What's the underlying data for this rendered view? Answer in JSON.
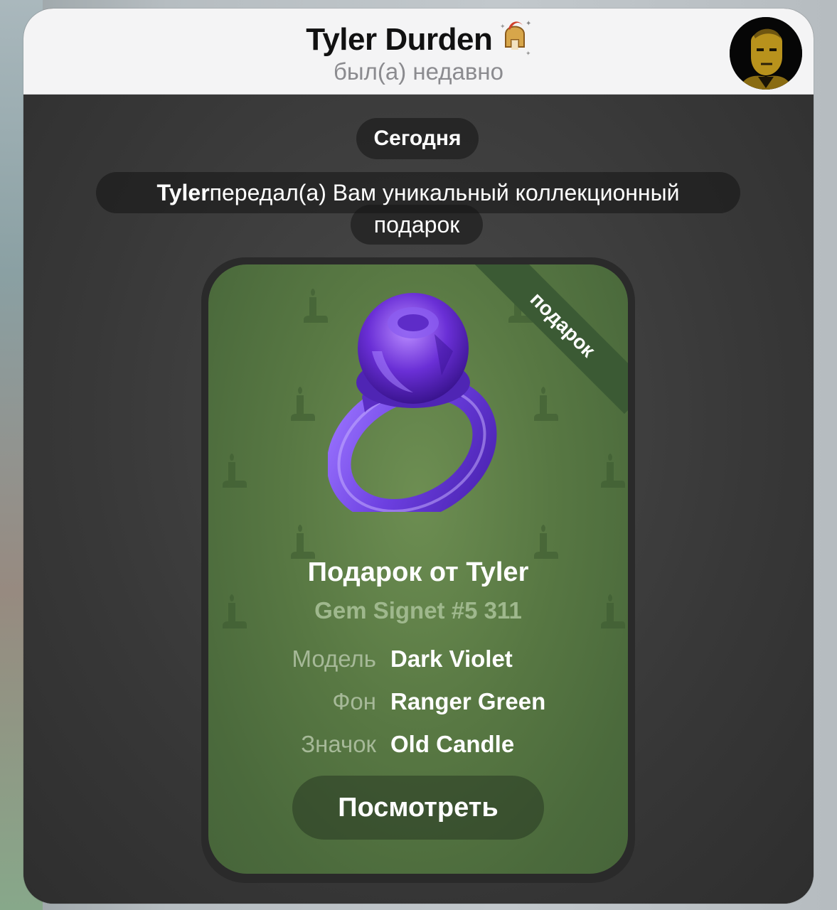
{
  "header": {
    "contact_name": "Tyler Durden",
    "status": "был(а) недавно",
    "emoji_status_icon": "spartan-helmet-icon",
    "avatar": "contact-avatar"
  },
  "chat": {
    "date_label": "Сегодня",
    "service_message": {
      "sender": "Tyler",
      "text_line1": " передал(а) Вам уникальный коллекционный",
      "text_line2": "подарок"
    },
    "gift_card": {
      "ribbon": "подарок",
      "title": "Подарок от Tyler",
      "subtitle": "Gem Signet #5 311",
      "attributes": [
        {
          "label": "Модель",
          "value": "Dark Violet"
        },
        {
          "label": "Фон",
          "value": "Ranger Green"
        },
        {
          "label": "Значок",
          "value": "Old Candle"
        }
      ],
      "button_label": "Посмотреть",
      "item_icon": "gem-ring-icon",
      "pattern_icon": "candle-icon"
    }
  },
  "colors": {
    "header_bg": "#f4f4f5",
    "card_bg": "#587843",
    "ring": "#7b3fe0",
    "muted_green": "#a6b998"
  }
}
